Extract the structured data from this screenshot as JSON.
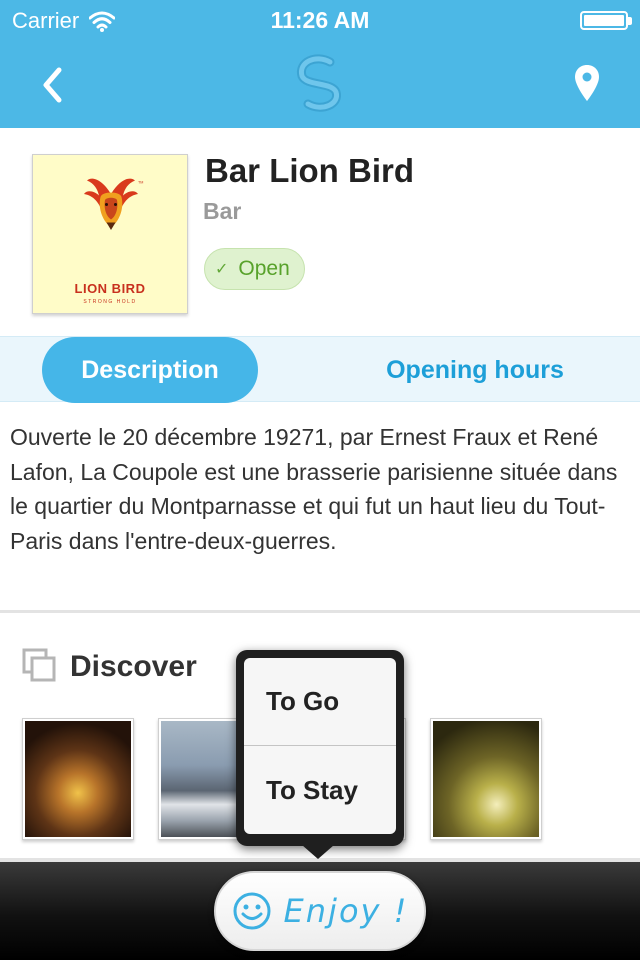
{
  "status_bar": {
    "carrier": "Carrier",
    "time": "11:26 AM",
    "battery_level": 1.0,
    "icons": [
      "wifi-icon",
      "battery-icon"
    ]
  },
  "nav": {
    "icons": [
      "back-chevron-icon",
      "app-logo-icon",
      "location-pin-icon"
    ]
  },
  "venue": {
    "name": "Bar Lion Bird",
    "type": "Bar",
    "status": "Open",
    "logo": {
      "text": "LION BIRD",
      "subtext": "STRONG HOLD"
    }
  },
  "tabs": {
    "description": "Description",
    "opening_hours": "Opening hours",
    "active": "description"
  },
  "description": "Ouverte le 20 décembre 19271, par Ernest Fraux et René Lafon, La Coupole est une brasserie parisienne située dans le quartier du Montparnasse et qui fut un haut lieu du Tout-Paris dans l'entre-deux-guerres.",
  "discover": {
    "title": "Discover",
    "icon": "gallery-icon",
    "thumbnails": 4
  },
  "popover": {
    "options": [
      "To Go",
      "To Stay"
    ]
  },
  "bottom_bar": {
    "enjoy_label": "Enjoy !",
    "icon": "smiley-icon"
  },
  "colors": {
    "header": "#4cb8e6",
    "tab_active": "#45b6e8",
    "tab_text": "#1d9fd8",
    "open_badge": "#dff2cf",
    "open_text": "#58a22b",
    "enjoy_text": "#3cb0e2"
  }
}
